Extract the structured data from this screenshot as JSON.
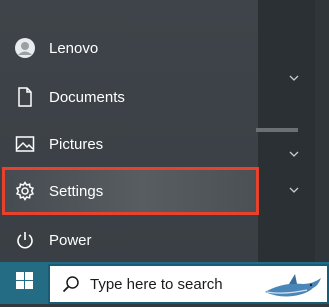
{
  "start_menu": {
    "items": [
      {
        "label": "Lenovo",
        "icon": "user-avatar-icon"
      },
      {
        "label": "Documents",
        "icon": "document-icon"
      },
      {
        "label": "Pictures",
        "icon": "picture-icon"
      },
      {
        "label": "Settings",
        "icon": "gear-icon",
        "selected": true
      },
      {
        "label": "Power",
        "icon": "power-icon"
      }
    ],
    "highlight_color": "#e8412c"
  },
  "taskbar": {
    "search_placeholder": "Type here to search",
    "start_icon": "windows-logo-icon",
    "search_icon": "search-icon",
    "accent": "#1f6d8a"
  }
}
